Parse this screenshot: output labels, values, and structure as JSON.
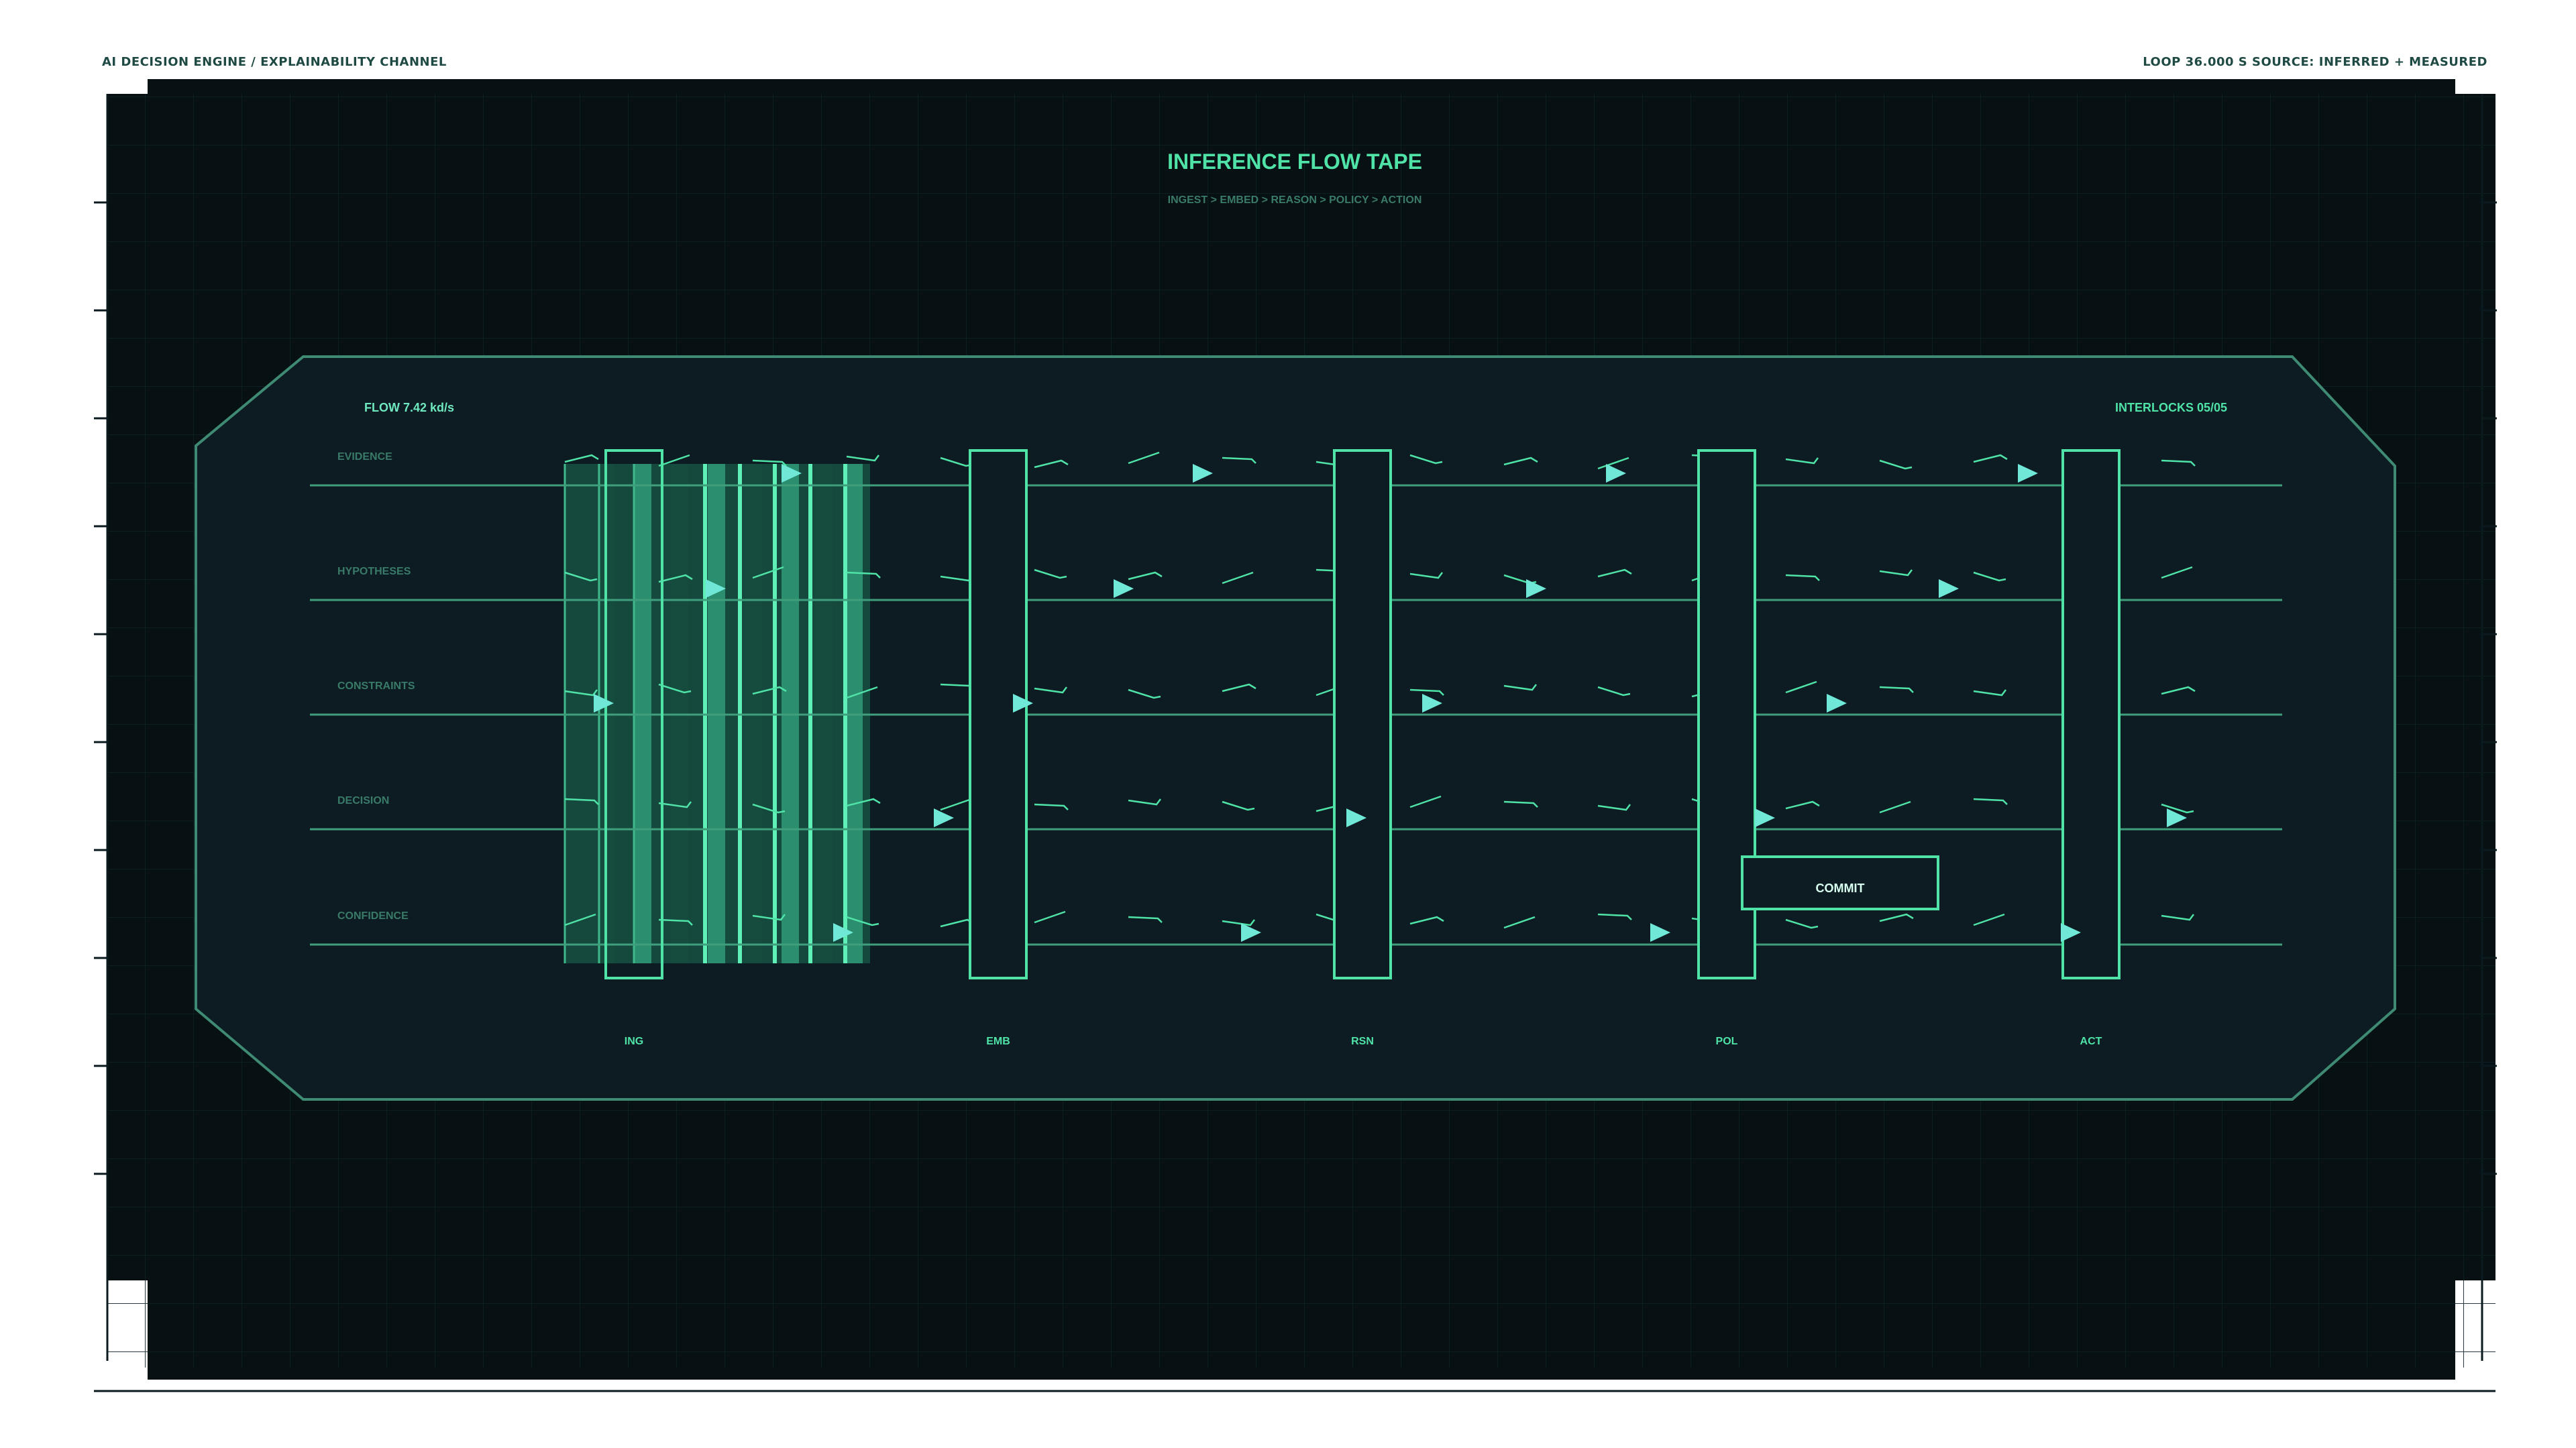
{
  "header": {
    "left": "AI DECISION ENGINE / EXPLAINABILITY CHANNEL",
    "right": "LOOP 36.000 S  SOURCE: INFERRED + MEASURED"
  },
  "diagram": {
    "title": "INFERENCE FLOW TAPE",
    "subtitle": "INGEST > EMBED > REASON > POLICY > ACTION",
    "flow_readout": "FLOW 7.42 kd/s",
    "interlocks_readout": "INTERLOCKS 05/05",
    "lanes": [
      "EVIDENCE",
      "HYPOTHESES",
      "CONSTRAINTS",
      "DECISION",
      "CONFIDENCE"
    ],
    "stages": [
      "ING",
      "EMB",
      "RSN",
      "POL",
      "ACT"
    ],
    "commit_label": "COMMIT"
  },
  "colors": {
    "background": "#ffffff",
    "outer_panel": "#071013",
    "tape_panel": "#0c1c22",
    "accent": "#4fe3a8",
    "lane_line": "#3f9e7c",
    "label_dim": "#3a7a68",
    "marker": "#6fe8d8"
  }
}
